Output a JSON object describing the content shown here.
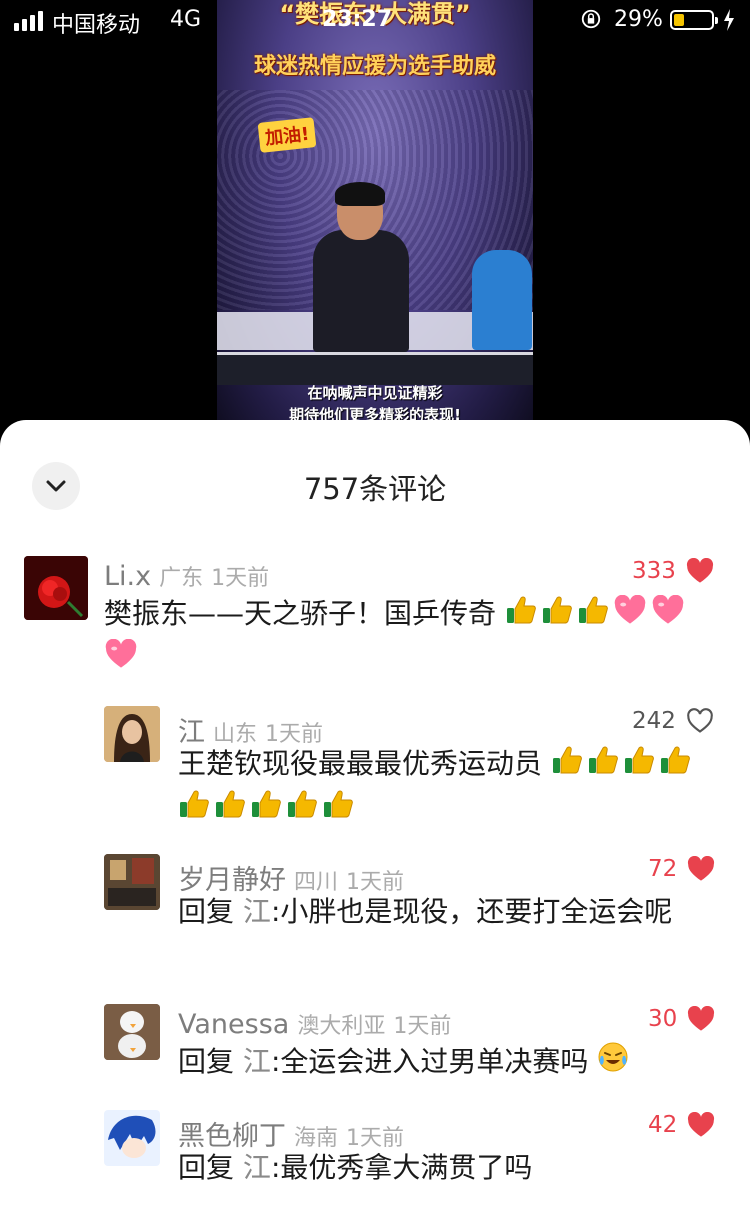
{
  "status_bar": {
    "carrier": "中国移动",
    "network": "4G",
    "time": "23:27",
    "battery_percent": "29%",
    "battery_level": 0.29
  },
  "video": {
    "headline_top": "“樊振东”大满贯”",
    "headline_sub": "球迷热情应援为选手助威",
    "cheer_tag": "加油!",
    "subtitle_line1": "在呐喊声中见证精彩",
    "subtitle_line2": "期待他们更多精彩的表现!"
  },
  "comments_sheet": {
    "title": "757条评论",
    "comments": [
      {
        "name": "Li.x",
        "location": "广东",
        "time": "1天前",
        "likes": "333",
        "liked": true,
        "text": "樊振东——天之骄子！国乒传奇",
        "emojis": [
          "thumbs-up",
          "thumbs-up",
          "thumbs-up",
          "pink-heart",
          "pink-heart",
          "pink-heart"
        ]
      },
      {
        "name": "江",
        "location": "山东",
        "time": "1天前",
        "likes": "242",
        "liked": false,
        "text": "王楚钦现役最最最优秀运动员",
        "emojis": [
          "thumbs-up",
          "thumbs-up",
          "thumbs-up",
          "thumbs-up",
          "thumbs-up",
          "thumbs-up",
          "thumbs-up",
          "thumbs-up",
          "thumbs-up"
        ]
      },
      {
        "name": "岁月静好",
        "location": "四川",
        "time": "1天前",
        "likes": "72",
        "liked": true,
        "reply_prefix": "回复",
        "reply_to": "江",
        "text": ":小胖也是现役，还要打全运会呢"
      },
      {
        "name": "Vanessa",
        "location": "澳大利亚",
        "time": "1天前",
        "likes": "30",
        "liked": true,
        "reply_prefix": "回复",
        "reply_to": "江",
        "text": ":全运会进入过男单决赛吗",
        "emojis": [
          "crying-laughing"
        ]
      },
      {
        "name": "黑色柳丁",
        "location": "海南",
        "time": "1天前",
        "likes": "42",
        "liked": true,
        "reply_prefix": "回复",
        "reply_to": "江",
        "text": ":最优秀拿大满贯了吗"
      }
    ]
  },
  "colors": {
    "like_red": "#e8424d",
    "sheet_bg": "#ffffff",
    "name_gray": "#7d7d7d",
    "meta_gray": "#ababab",
    "text_dark": "#1b1b1b"
  }
}
